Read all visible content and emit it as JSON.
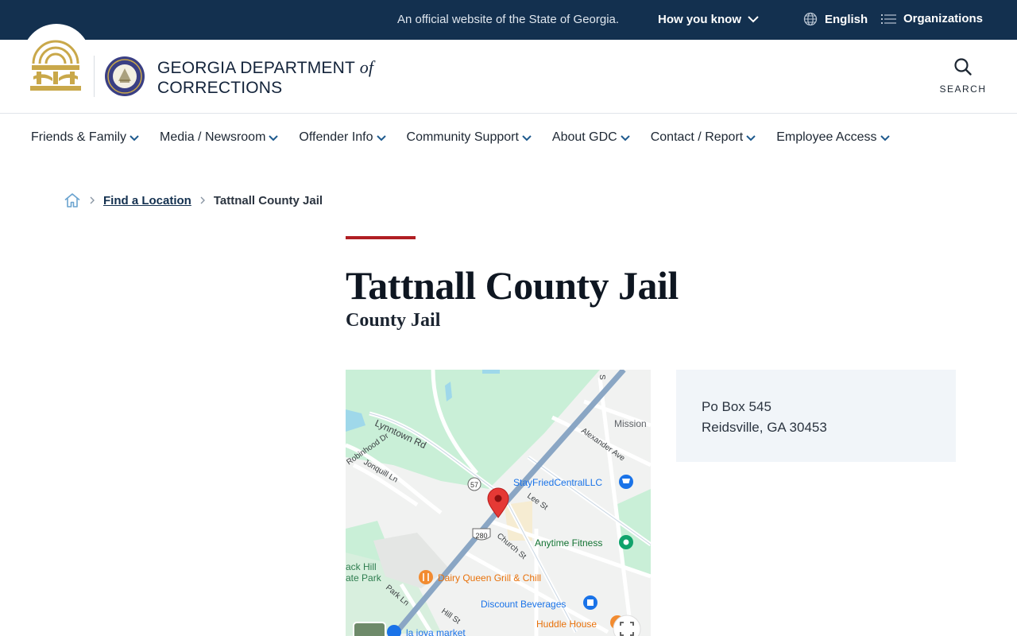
{
  "topbar": {
    "official_text": "An official website of the State of Georgia.",
    "how_you_know": "How you know",
    "language": "English",
    "organizations": "Organizations"
  },
  "header": {
    "dept_name_line1": "GEORGIA DEPARTMENT",
    "dept_name_of": "of",
    "dept_name_line2": "CORRECTIONS",
    "search_label": "SEARCH"
  },
  "nav": {
    "items": [
      {
        "label": "Friends & Family"
      },
      {
        "label": "Media / Newsroom"
      },
      {
        "label": "Offender Info"
      },
      {
        "label": "Community Support"
      },
      {
        "label": "About GDC"
      },
      {
        "label": "Contact / Report"
      },
      {
        "label": "Employee Access"
      }
    ]
  },
  "breadcrumb": {
    "parent": "Find a Location",
    "current": "Tattnall County Jail"
  },
  "page": {
    "title": "Tattnall County Jail",
    "subtitle": "County Jail"
  },
  "address": {
    "line1": "Po Box 545",
    "line2": "Reidsville, GA 30453"
  },
  "map": {
    "labels": {
      "lynntown": "Lynntown Rd",
      "robinhood": "Robinhood Dr",
      "jonquill": "Jonquill Ln",
      "mission": "Mission",
      "alexander": "Alexander Ave",
      "lee": "Lee St",
      "church": "Church St",
      "park": "Park Ln",
      "hill": "Hill St",
      "state_park": "ack Hill\nate Park",
      "route57": "57",
      "route280": "280",
      "stayfried": "StayFriedCentralLLC",
      "anytime": "Anytime Fitness",
      "dairyqueen": "Dairy Queen Grill & Chill",
      "discount": "Discount Beverages",
      "huddle": "Huddle House",
      "lajoya": "la joya market",
      "s": "S"
    },
    "colors": {
      "park": "#c9efd7",
      "road_major": "#8aa6c4",
      "road_minor": "#ffffff",
      "water": "#9fd8ea",
      "pin": "#e53935"
    }
  },
  "colors": {
    "topbar_bg": "#13304f",
    "accent_red": "#b01e23",
    "address_bg": "#f1f5f9"
  }
}
